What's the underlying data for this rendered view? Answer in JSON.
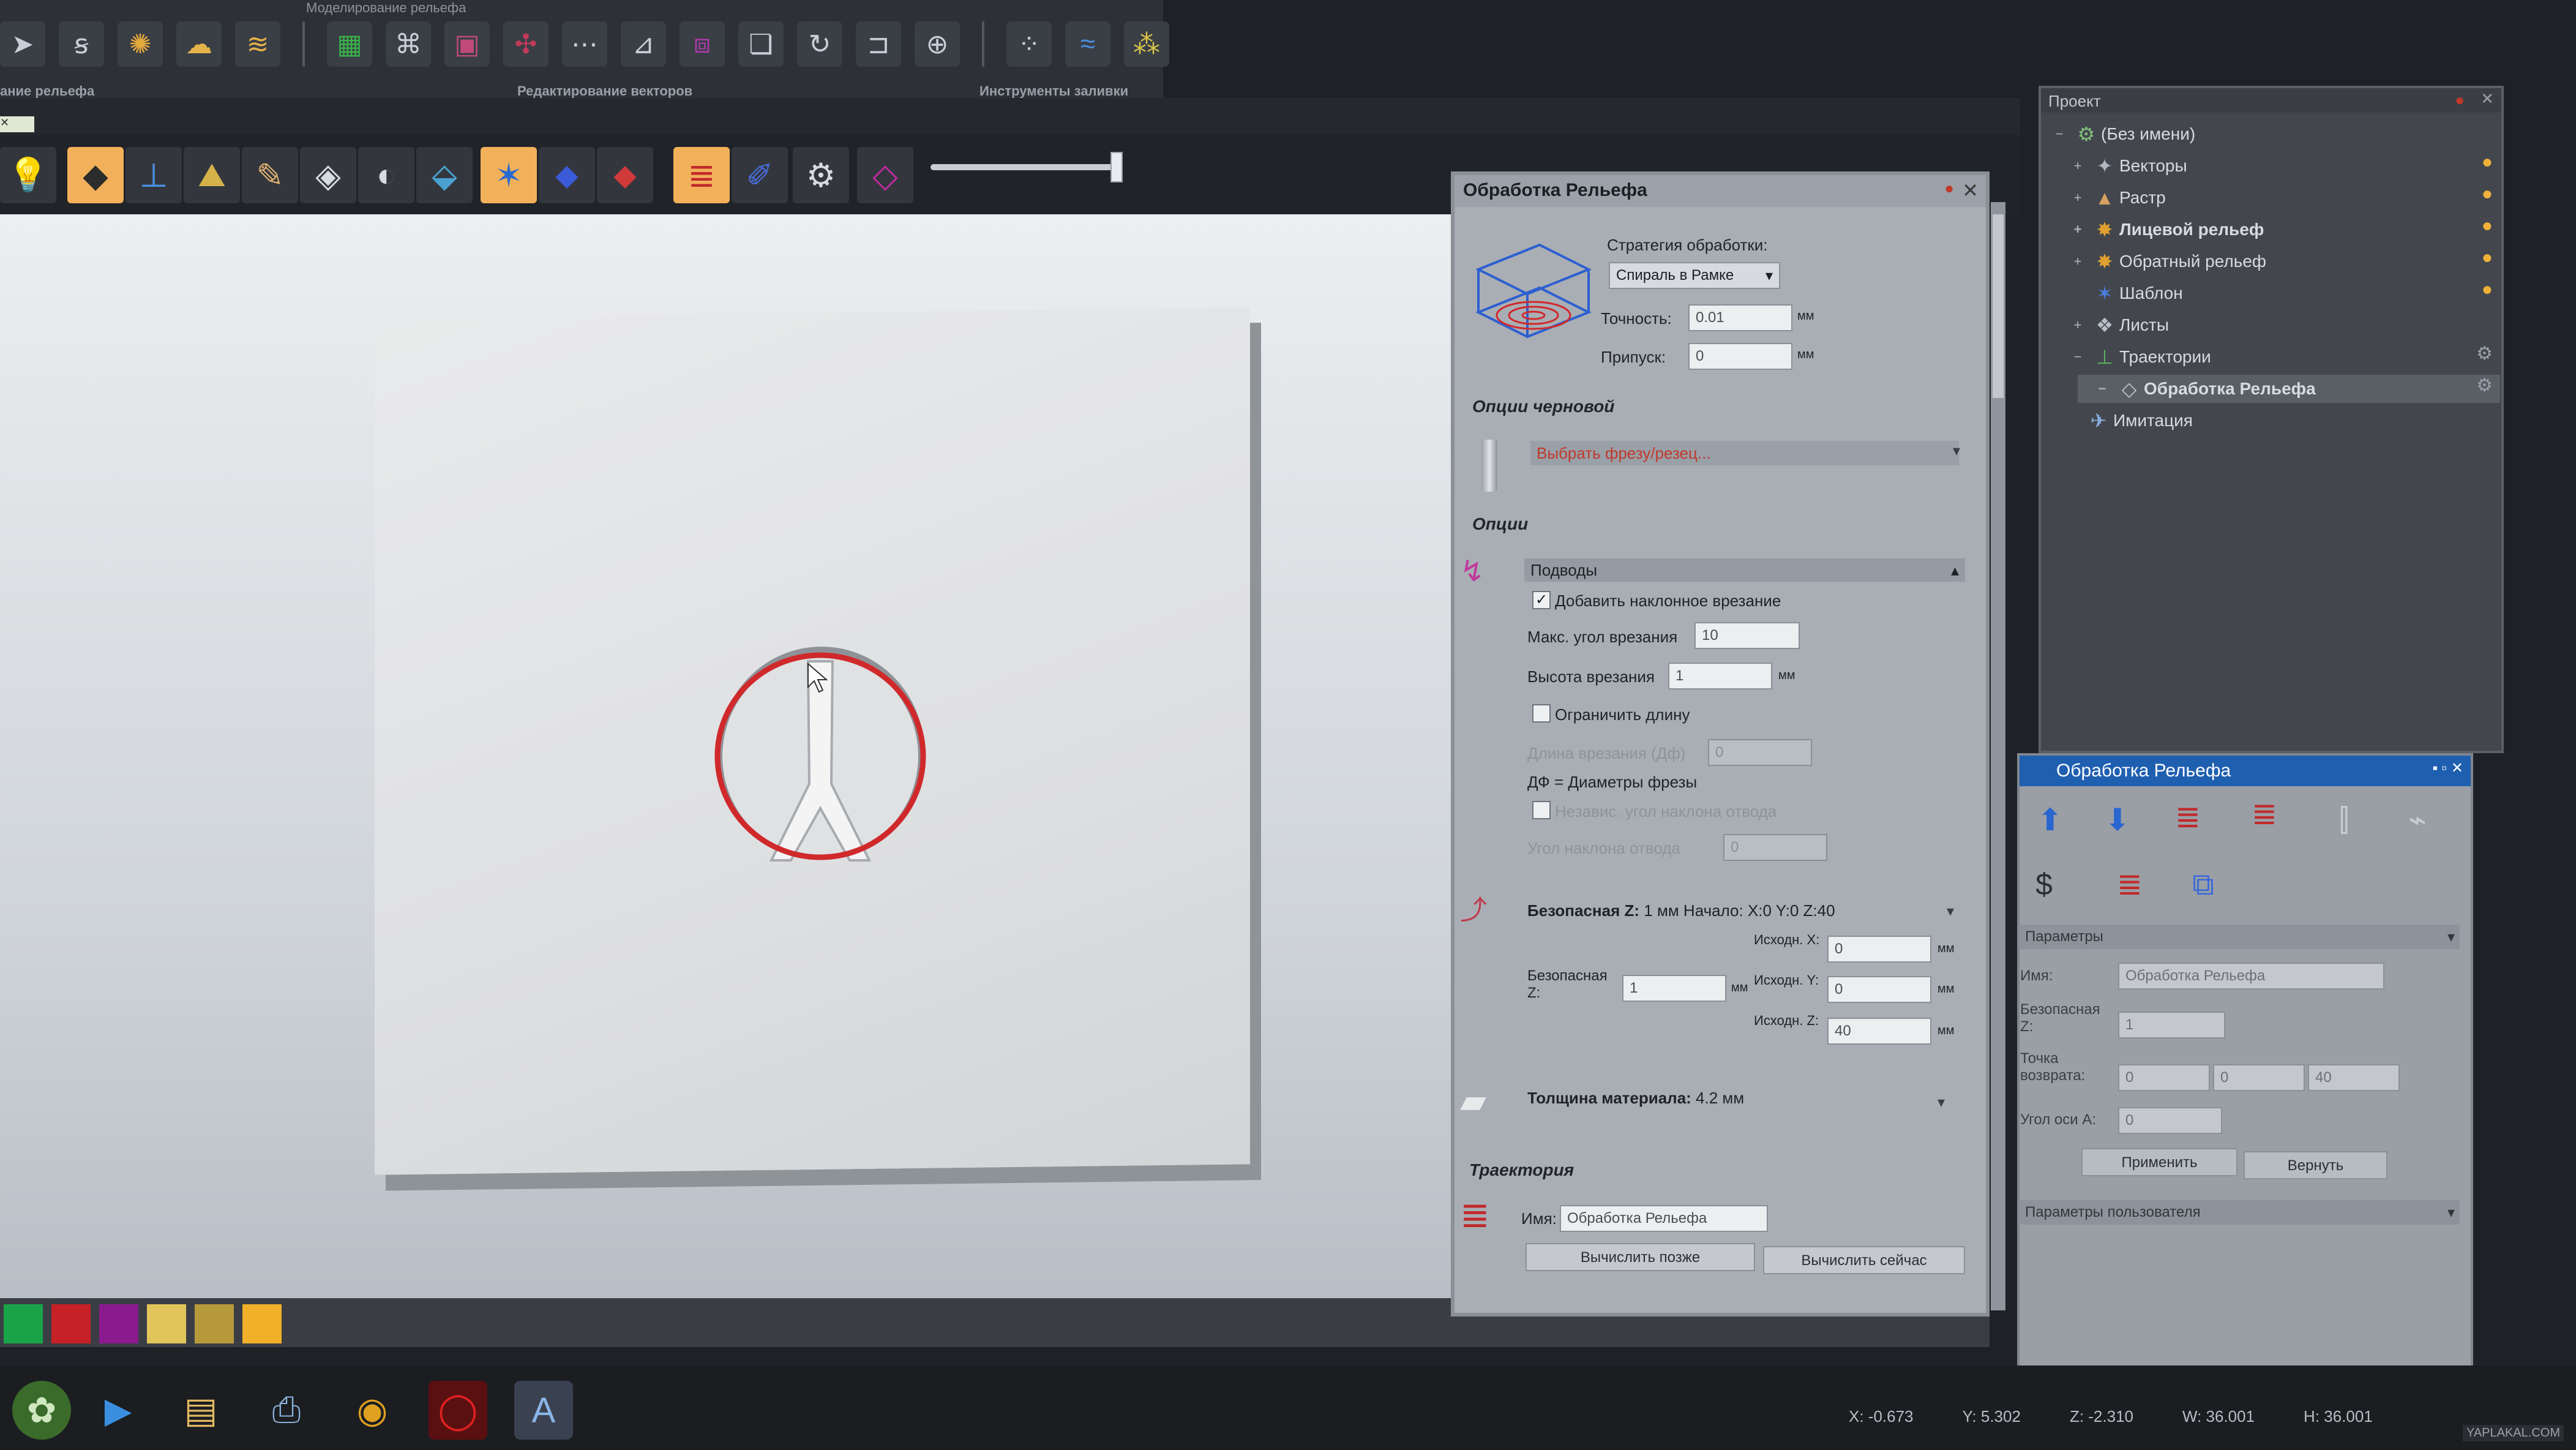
{
  "toolbar_top": {
    "strip_title": "Моделирование рельефа",
    "left_label": "ание рельефа",
    "group_labels": [
      "Редактирование векторов",
      "Инструменты заливки"
    ]
  },
  "machining_panel": {
    "title": "Обработка Рельефа",
    "strategy_label": "Стратегия обработки:",
    "strategy_value": "Спираль в Рамке",
    "accuracy_label": "Точность:",
    "accuracy_value": "0.01",
    "accuracy_unit": "мм",
    "allowance_label": "Припуск:",
    "allowance_value": "0",
    "allowance_unit": "мм",
    "rough_options_heading": "Опции черновой",
    "tool_select_text": "Выбрать фрезу/резец...",
    "options_heading": "Опции",
    "approaches_heading": "Подводы",
    "ramp_checkbox_label": "Добавить наклонное врезание",
    "ramp_checked": true,
    "max_angle_label": "Макс. угол врезания",
    "max_angle_value": "10",
    "ramp_height_label": "Высота врезания",
    "ramp_height_value": "1",
    "ramp_height_unit": "мм",
    "limit_length_label": "Ограничить длину",
    "limit_length_checked": false,
    "ramp_length_label": "Длина врезания (Дф)",
    "ramp_length_value": "0",
    "df_note": "ДФ = Диаметры фрезы",
    "indep_angle_label": "Независ. угол наклона отвода",
    "indep_angle_checked": false,
    "retract_angle_label": "Угол наклона отвода",
    "retract_angle_value": "0",
    "safe_z_heading_bold": "Безопасная Z:",
    "safe_z_heading_rest": " 1 мм  Начало: X:0 Y:0 Z:40",
    "safe_z_label": "Безопасная Z:",
    "safe_z_value": "1",
    "safe_z_unit": "мм",
    "home_x_label": "Исходн. X:",
    "home_x_value": "0",
    "home_y_label": "Исходн. Y:",
    "home_y_value": "0",
    "home_z_label": "Исходн. Z:",
    "home_z_value": "40",
    "home_unit": "мм",
    "thickness_heading_bold": "Толщина материала:",
    "thickness_heading_rest": " 4.2 мм",
    "toolpath_heading": "Траектория",
    "name_label": "Имя:",
    "name_value": "Обработка Рельефа",
    "calc_later": "Вычислить позже",
    "calc_now": "Вычислить сейчас"
  },
  "project_panel": {
    "title": "Проект",
    "items": [
      {
        "label": "(Без имени)",
        "icon": "project-icon"
      },
      {
        "label": "Векторы",
        "icon": "vectors-icon"
      },
      {
        "label": "Растр",
        "icon": "raster-icon"
      },
      {
        "label": "Лицевой рельеф",
        "icon": "front-relief-icon"
      },
      {
        "label": "Обратный рельеф",
        "icon": "back-relief-icon"
      },
      {
        "label": "Шаблон",
        "icon": "template-icon"
      },
      {
        "label": "Листы",
        "icon": "sheets-icon"
      },
      {
        "label": "Траектории",
        "icon": "toolpaths-icon"
      },
      {
        "label": "Обработка Рельефа",
        "icon": "relief-toolpath-icon"
      },
      {
        "label": "Имитация",
        "icon": "simulation-icon"
      }
    ]
  },
  "sub_panel": {
    "title": "Обработка Рельефа",
    "params_heading": "Параметры",
    "name_label": "Имя:",
    "name_value": "Обработка Рельефа",
    "safe_z_label": "Безопасная Z:",
    "safe_z_value": "1",
    "return_point_label": "Точка возврата:",
    "return_x": "0",
    "return_y": "0",
    "return_z": "40",
    "axis_angle_label": "Угол оси A:",
    "axis_angle_value": "0",
    "apply_button": "Применить",
    "revert_button": "Вернуть",
    "user_params_heading": "Параметры пользователя"
  },
  "status_bar": {
    "x": "X: -0.673",
    "y": "Y: 5.302",
    "z": "Z: -2.310",
    "w": "W: 36.001",
    "h": "H: 36.001"
  },
  "watermark": "YAPLAKAL.COM",
  "colors": {
    "accent_orange": "#f3b05a",
    "panel_title_blue": "#1f5fb0",
    "relief_outline_red": "#d0292b",
    "swatches": [
      "#1aa44a",
      "#c62127",
      "#8b1a8f",
      "#e2c55a",
      "#b69a3a",
      "#f0b02a"
    ]
  }
}
